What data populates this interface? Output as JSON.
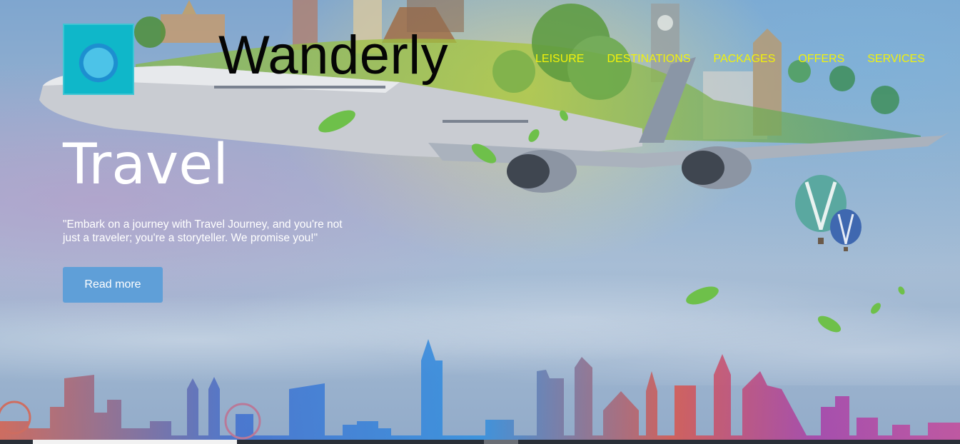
{
  "brand": {
    "name": "Wanderly",
    "logo_icon": "globe-travel-logo-icon"
  },
  "nav": {
    "items": [
      {
        "label": "LEISURE"
      },
      {
        "label": "DESTINATIONS"
      },
      {
        "label": "PACKAGES"
      },
      {
        "label": "OFFERS"
      },
      {
        "label": "SERVICES"
      }
    ],
    "color": "#f2f20a"
  },
  "hero": {
    "title": "Travel",
    "tagline": "\"Embark on a journey with Travel Journey, and you're not just a traveler; you're a storyteller. We promise you!\"",
    "cta_label": "Read more",
    "cta_color": "#5f9fd8"
  },
  "background": {
    "icons": [
      "airplane-icon",
      "landmarks-icon",
      "hot-air-balloon-icon",
      "leaf-icon",
      "city-skyline-icon"
    ]
  }
}
